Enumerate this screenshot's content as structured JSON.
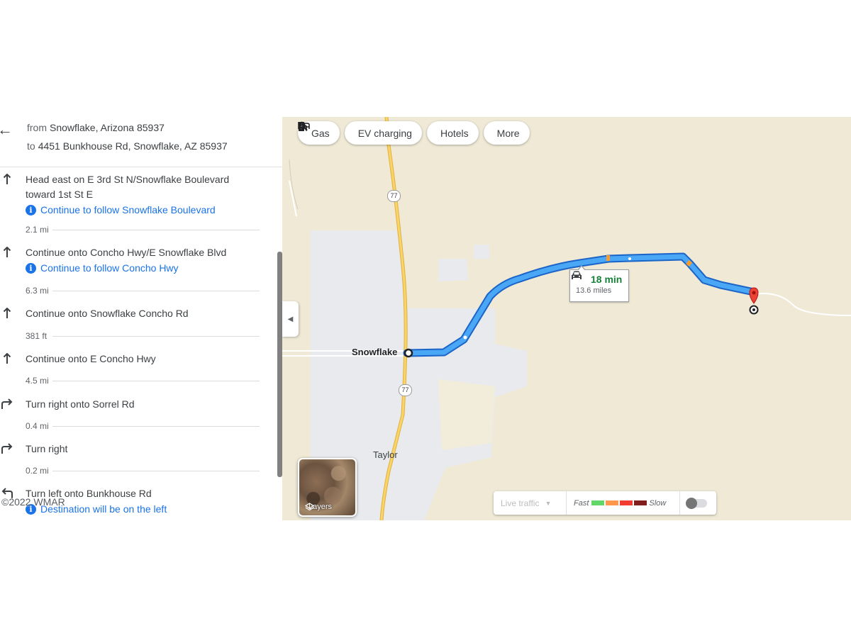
{
  "directions": {
    "from_prefix": "from",
    "from_place": "Snowflake, Arizona 85937",
    "to_prefix": "to",
    "to_place": "4451 Bunkhouse Rd, Snowflake, AZ 85937",
    "steps": [
      {
        "instruction": "Head east on E 3rd St N/Snowflake Boulevard toward 1st St E",
        "note": "Continue to follow Snowflake Boulevard",
        "distance": "2.1 mi",
        "icon": "straight-arrow-icon"
      },
      {
        "instruction": "Continue onto Concho Hwy/E Snowflake Blvd",
        "note": "Continue to follow Concho Hwy",
        "distance": "6.3 mi",
        "icon": "straight-arrow-icon"
      },
      {
        "instruction": "Continue onto Snowflake Concho Rd",
        "distance": "381 ft",
        "icon": "straight-arrow-icon"
      },
      {
        "instruction": "Continue onto E Concho Hwy",
        "distance": "4.5 mi",
        "icon": "straight-arrow-icon"
      },
      {
        "instruction": "Turn right onto Sorrel Rd",
        "distance": "0.4 mi",
        "icon": "turn-right-icon"
      },
      {
        "instruction": "Turn right",
        "distance": "0.2 mi",
        "icon": "turn-right-icon"
      },
      {
        "instruction": "Turn left onto Bunkhouse Rd",
        "note": "Destination will be on the left",
        "icon": "turn-left-icon"
      }
    ]
  },
  "map": {
    "chips": [
      {
        "label": "Gas",
        "icon": "gas-station-icon"
      },
      {
        "label": "EV charging",
        "icon": "ev-charging-icon"
      },
      {
        "label": "Hotels",
        "icon": "hotel-bed-icon"
      },
      {
        "label": "More",
        "icon": "search-icon"
      }
    ],
    "town_label": "Snowflake",
    "town_label_2": "Taylor",
    "highway_shield": "77",
    "eta_time": "18 min",
    "eta_distance": "13.6 miles",
    "layers_label": "Layers",
    "traffic": {
      "dropdown_label": "Live traffic",
      "fast_label": "Fast",
      "slow_label": "Slow",
      "colors": [
        "#63d668",
        "#ff974d",
        "#f23c32",
        "#811f1f"
      ]
    },
    "colors": {
      "route": "#1a73e8",
      "route_light": "#4fc3f7",
      "land": "#efe9d6",
      "urban": "#e8eaed",
      "highway": "#f6c94b",
      "destination_pin": "#ea4335"
    }
  },
  "copyright": "©2022 WMAR"
}
